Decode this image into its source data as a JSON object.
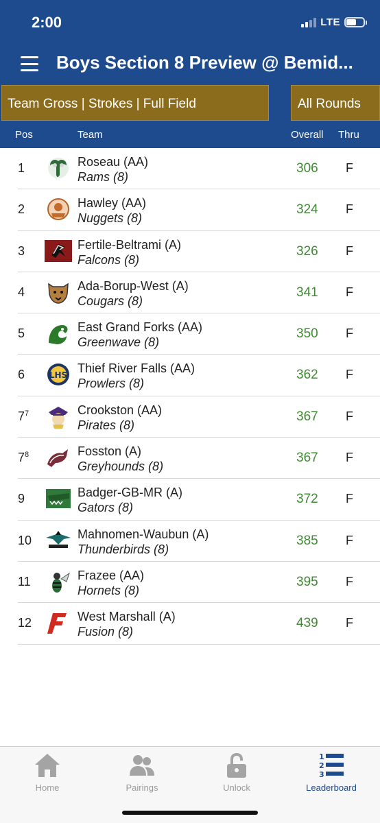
{
  "status_bar": {
    "time": "2:00",
    "network": "LTE"
  },
  "header": {
    "title": "Boys Section 8 Preview @ Bemid..."
  },
  "filters": {
    "left": "Team Gross | Strokes | Full Field",
    "right": "All Rounds"
  },
  "table": {
    "columns": {
      "pos": "Pos",
      "team": "Team",
      "overall": "Overall",
      "thru": "Thru"
    },
    "rows": [
      {
        "pos": "1",
        "pos_sup": "",
        "school": "Roseau (AA)",
        "mascot": "Rams (8)",
        "overall": "306",
        "thru": "F",
        "logo": "ram-logo-icon"
      },
      {
        "pos": "2",
        "pos_sup": "",
        "school": "Hawley (AA)",
        "mascot": "Nuggets (8)",
        "overall": "324",
        "thru": "F",
        "logo": "nugget-logo-icon"
      },
      {
        "pos": "3",
        "pos_sup": "",
        "school": "Fertile-Beltrami (A)",
        "mascot": "Falcons (8)",
        "overall": "326",
        "thru": "F",
        "logo": "falcon-logo-icon"
      },
      {
        "pos": "4",
        "pos_sup": "",
        "school": "Ada-Borup-West (A)",
        "mascot": "Cougars (8)",
        "overall": "341",
        "thru": "F",
        "logo": "cougar-logo-icon"
      },
      {
        "pos": "5",
        "pos_sup": "",
        "school": "East Grand Forks (AA)",
        "mascot": "Greenwave (8)",
        "overall": "350",
        "thru": "F",
        "logo": "greenwave-logo-icon"
      },
      {
        "pos": "6",
        "pos_sup": "",
        "school": "Thief River Falls (AA)",
        "mascot": "Prowlers (8)",
        "overall": "362",
        "thru": "F",
        "logo": "prowler-logo-icon"
      },
      {
        "pos": "7",
        "pos_sup": "7",
        "school": "Crookston (AA)",
        "mascot": "Pirates (8)",
        "overall": "367",
        "thru": "F",
        "logo": "pirate-logo-icon"
      },
      {
        "pos": "7",
        "pos_sup": "8",
        "school": "Fosston (A)",
        "mascot": "Greyhounds (8)",
        "overall": "367",
        "thru": "F",
        "logo": "greyhound-logo-icon"
      },
      {
        "pos": "9",
        "pos_sup": "",
        "school": "Badger-GB-MR (A)",
        "mascot": "Gators (8)",
        "overall": "372",
        "thru": "F",
        "logo": "gator-logo-icon"
      },
      {
        "pos": "10",
        "pos_sup": "",
        "school": "Mahnomen-Waubun (A)",
        "mascot": "Thunderbirds (8)",
        "overall": "385",
        "thru": "F",
        "logo": "thunderbird-logo-icon"
      },
      {
        "pos": "11",
        "pos_sup": "",
        "school": "Frazee (AA)",
        "mascot": "Hornets (8)",
        "overall": "395",
        "thru": "F",
        "logo": "hornet-logo-icon"
      },
      {
        "pos": "12",
        "pos_sup": "",
        "school": "West Marshall (A)",
        "mascot": "Fusion (8)",
        "overall": "439",
        "thru": "F",
        "logo": "fusion-logo-icon"
      }
    ]
  },
  "tabs": [
    {
      "label": "Home",
      "icon": "home-icon",
      "active": false
    },
    {
      "label": "Pairings",
      "icon": "pairings-icon",
      "active": false
    },
    {
      "label": "Unlock",
      "icon": "unlock-icon",
      "active": false
    },
    {
      "label": "Leaderboard",
      "icon": "leaderboard-icon",
      "active": true
    }
  ],
  "colors": {
    "primary": "#1e4a8e",
    "filter": "#8b6c1d",
    "score": "#3f8a33",
    "tab_inactive": "#9a9a9a"
  }
}
